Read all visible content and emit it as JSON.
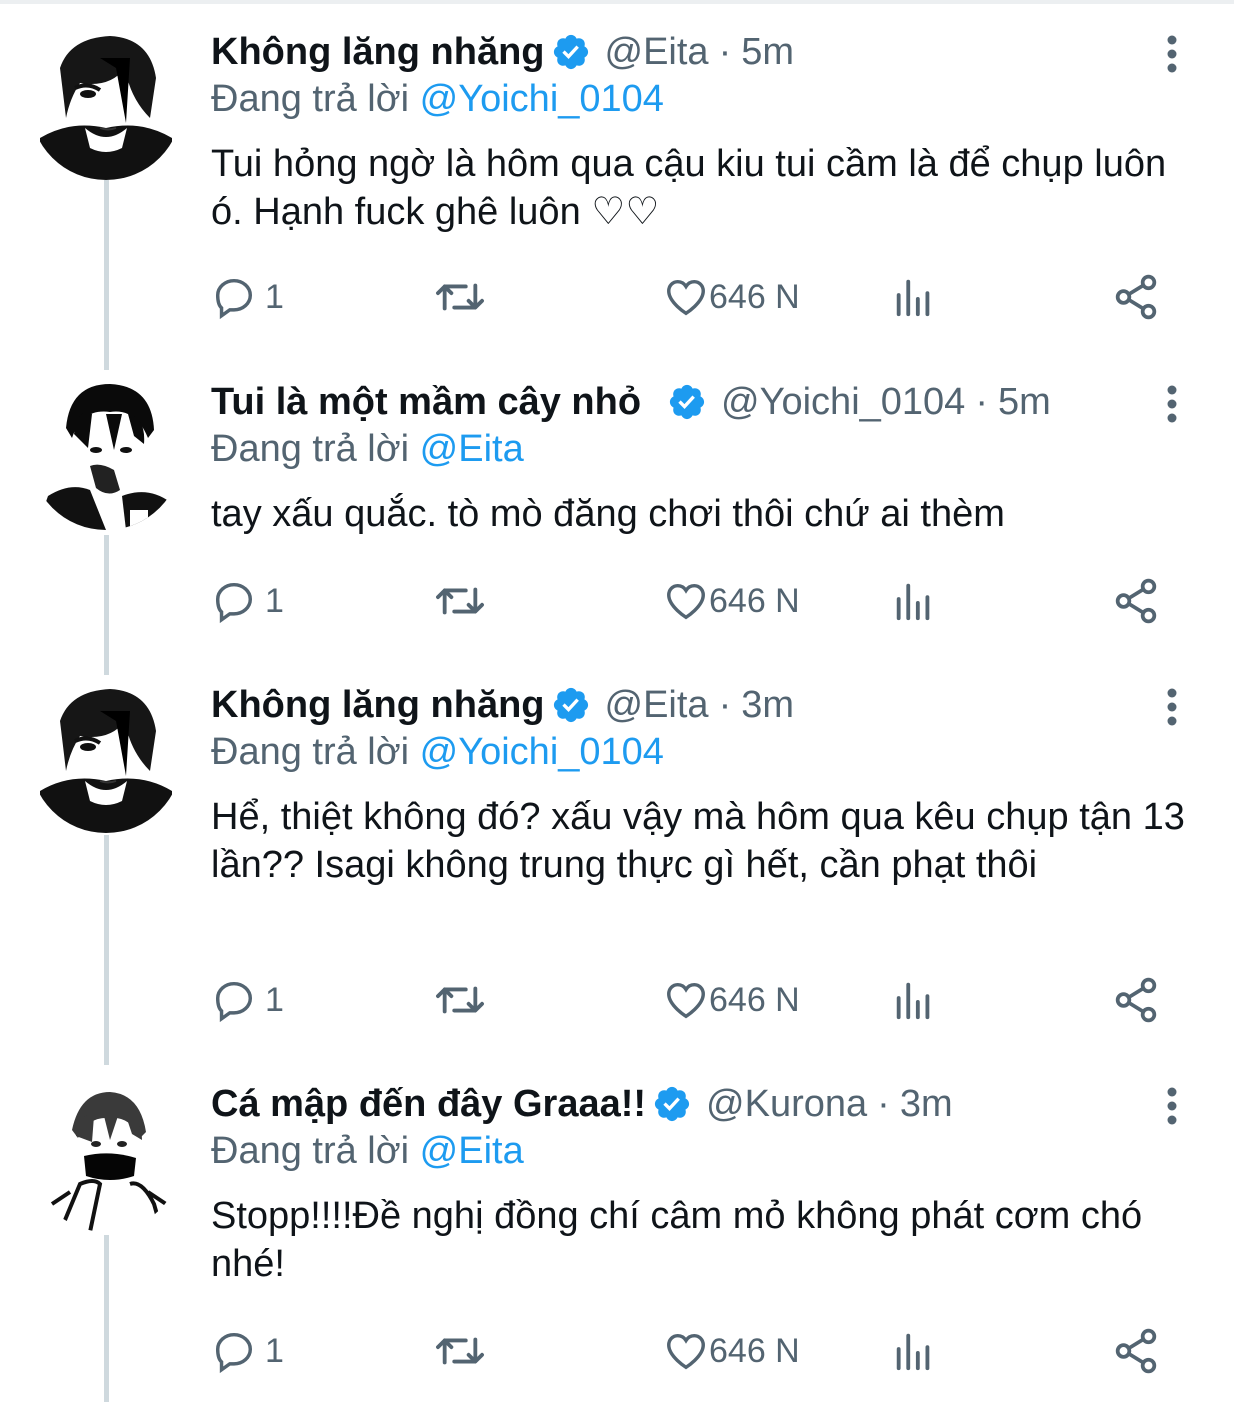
{
  "tweets": [
    {
      "display_name": "Không lăng nhăng",
      "handle": "@Eita",
      "separator": "·",
      "time": "5m",
      "replying_prefix": "Đang trả lời",
      "replying_to": "@Yoichi_0104",
      "text": "Tui hỏng ngờ là hôm qua cậu kiu tui cầm là để chụp luôn ó. Hạnh fuck ghê luôn ♡♡",
      "reply_count": "1",
      "like_count": "646 N"
    },
    {
      "display_name": "Tui là một mầm cây nhỏ",
      "handle": "@Yoichi_0104",
      "separator": "·",
      "time": "5m",
      "replying_prefix": "Đang trả lời",
      "replying_to": "@Eita",
      "text": "tay xấu quắc. tò mò đăng chơi thôi chứ ai thèm",
      "reply_count": "1",
      "like_count": "646 N"
    },
    {
      "display_name": "Không lăng nhăng",
      "handle": "@Eita",
      "separator": "·",
      "time": "3m",
      "replying_prefix": "Đang trả lời",
      "replying_to": "@Yoichi_0104",
      "text": "Hể, thiệt không đó? xấu vậy mà hôm qua kêu chụp tận 13 lần?? Isagi không trung thực gì hết, cần phạt thôi",
      "reply_count": "1",
      "like_count": "646 N"
    },
    {
      "display_name": "Cá mập đến đây Graaa!!",
      "handle": "@Kurona",
      "separator": "·",
      "time": "3m",
      "replying_prefix": "Đang trả lời",
      "replying_to": "@Eita",
      "text": "Stopp!!!!Đề nghị đồng chí câm mỏ không phát cơm chó nhé!",
      "reply_count": "1",
      "like_count": "646 N"
    }
  ],
  "colors": {
    "verified": "#1d9bf0",
    "mention": "#1d9bf0",
    "secondary_text": "#536471",
    "thread_line": "#cfd9de"
  },
  "icons": {
    "verified": "verified-badge-icon",
    "more": "more-vertical-icon",
    "reply": "reply-bubble-icon",
    "retweet": "retweet-icon",
    "like": "heart-icon",
    "views": "bar-chart-icon",
    "share": "share-icon"
  }
}
